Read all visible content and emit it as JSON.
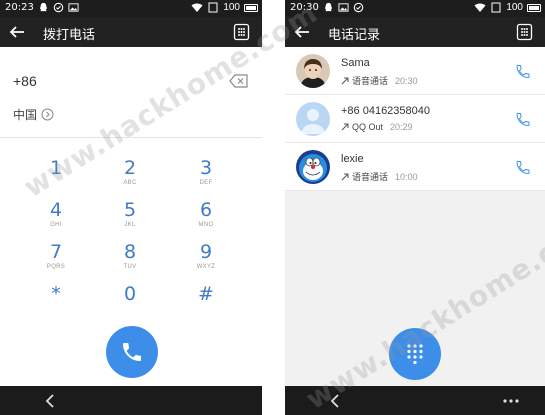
{
  "left": {
    "status": {
      "time": "20:23",
      "battery": "100"
    },
    "title": "拨打电话",
    "prefix": "+86",
    "country": "中国",
    "keys": [
      {
        "num": "1",
        "letters": ""
      },
      {
        "num": "2",
        "letters": "ABC"
      },
      {
        "num": "3",
        "letters": "DEF"
      },
      {
        "num": "4",
        "letters": "GHI"
      },
      {
        "num": "5",
        "letters": "JKL"
      },
      {
        "num": "6",
        "letters": "MNO"
      },
      {
        "num": "7",
        "letters": "PQRS"
      },
      {
        "num": "8",
        "letters": "TUV"
      },
      {
        "num": "9",
        "letters": "WXYZ"
      },
      {
        "num": "*",
        "letters": ""
      },
      {
        "num": "0",
        "letters": ""
      },
      {
        "num": "#",
        "letters": ""
      }
    ]
  },
  "right": {
    "status": {
      "time": "20:30",
      "battery": "100"
    },
    "title": "电话记录",
    "calls": [
      {
        "name": "Sama",
        "type": "语音通话",
        "time": "20:30",
        "avatar": "photo"
      },
      {
        "name": "+86 04162358040",
        "type": "QQ Out",
        "time": "20:29",
        "avatar": "default"
      },
      {
        "name": "lexie",
        "type": "语音通话",
        "time": "10:00",
        "avatar": "doraemon"
      }
    ]
  },
  "watermark": "www.hackhome.com",
  "colors": {
    "accent": "#3d8ee9",
    "key_text": "#3f7cc5",
    "bar": "#222222"
  }
}
